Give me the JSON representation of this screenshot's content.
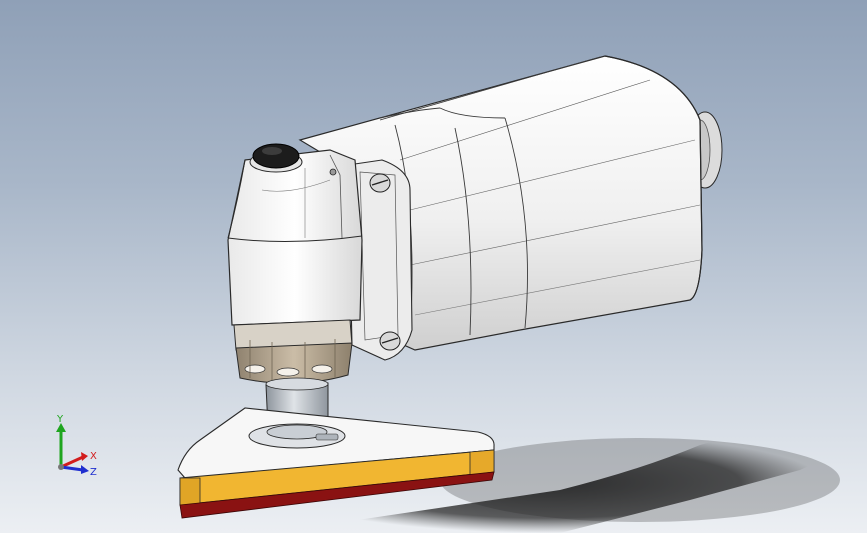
{
  "viewport": {
    "model": "orbital-sander"
  },
  "triad": {
    "y_label": "Y",
    "x_label": "X",
    "z_label": "Z",
    "colors": {
      "y": "#1fa51f",
      "x": "#d21d1d",
      "z": "#1f2ecf"
    }
  },
  "colors": {
    "body": "#f4f4f4",
    "body_shade": "#c9c9c9",
    "outline": "#2a2a2a",
    "collar": "#b9aa95",
    "spindle": "#c7ccd2",
    "pad_yellow": "#f1b631",
    "pad_red": "#8a1212"
  }
}
